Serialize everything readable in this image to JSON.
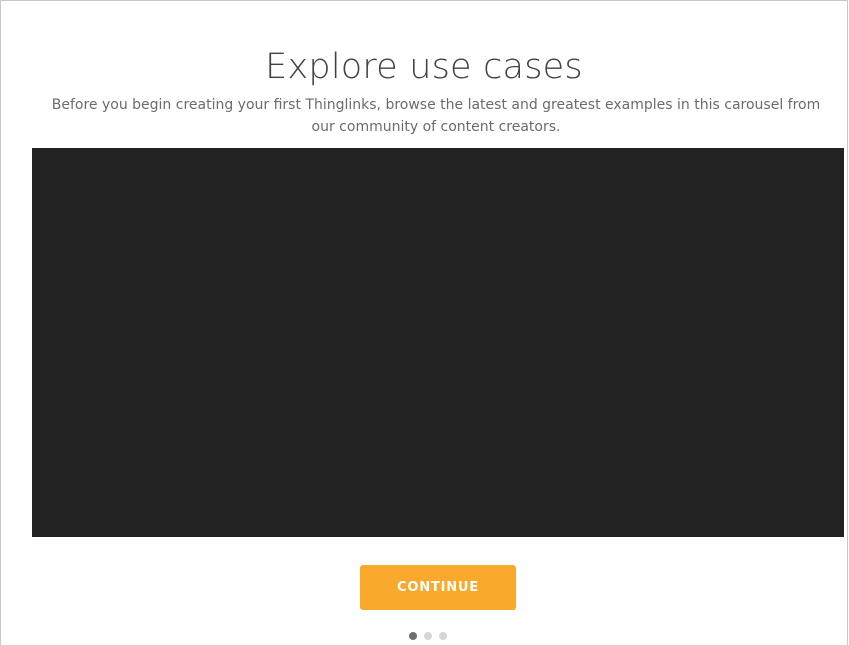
{
  "header": {
    "title": "Explore use cases",
    "subtitle": "Before you begin creating your first Thinglinks, browse the latest and greatest examples in this carousel from our community of content creators."
  },
  "carousel": {
    "background_color": "#222222",
    "active_slide": 1,
    "slide_count": 3
  },
  "actions": {
    "continue_label": "CONTINUE",
    "accent_color": "#f9a92b"
  }
}
